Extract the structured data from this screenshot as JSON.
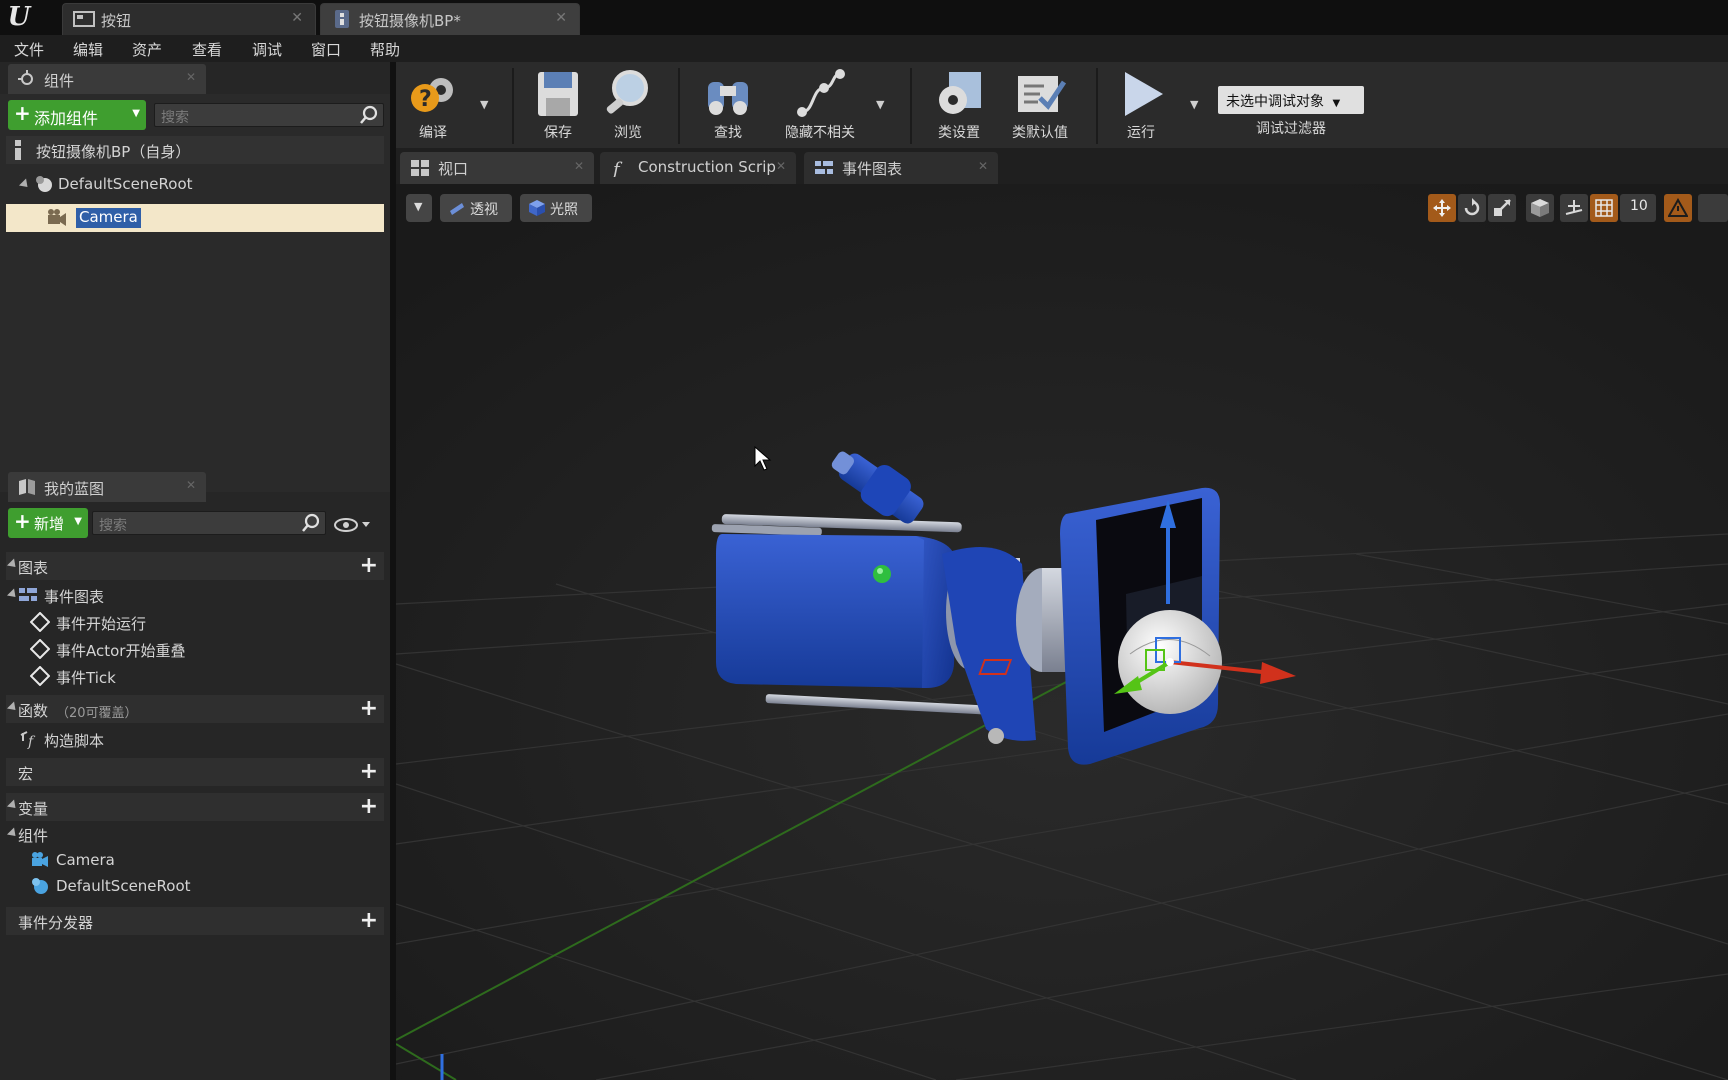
{
  "titlebar": {
    "tabs": [
      {
        "label": "按钮",
        "icon": "level-icon"
      },
      {
        "label": "按钮摄像机BP*",
        "icon": "blueprint-icon"
      }
    ]
  },
  "menubar": {
    "items": [
      "文件",
      "编辑",
      "资产",
      "查看",
      "调试",
      "窗口",
      "帮助"
    ]
  },
  "components_panel": {
    "tab_label": "组件",
    "add_button": "添加组件",
    "search_placeholder": "搜索",
    "self_label": "按钮摄像机BP（自身）",
    "tree": [
      {
        "label": "DefaultSceneRoot",
        "icon": "scene-root-icon"
      },
      {
        "label": "Camera",
        "icon": "camera-icon",
        "selected": true
      }
    ]
  },
  "my_blueprint_panel": {
    "tab_label": "我的蓝图",
    "add_button": "新增",
    "search_placeholder": "搜索",
    "sections": {
      "graphs": "图表",
      "event_graph": "事件图表",
      "events": [
        "事件开始运行",
        "事件Actor开始重叠",
        "事件Tick"
      ],
      "functions": "函数",
      "functions_note": "（20可覆盖）",
      "construction_script": "构造脚本",
      "macros": "宏",
      "variables": "变量",
      "components": "组件",
      "component_items": [
        "Camera",
        "DefaultSceneRoot"
      ],
      "event_dispatchers": "事件分发器"
    }
  },
  "toolbar": {
    "compile": "编译",
    "save": "保存",
    "browse": "浏览",
    "find": "查找",
    "hide_unrelated": "隐藏不相关",
    "class_settings": "类设置",
    "class_defaults": "类默认值",
    "play": "运行",
    "debug_object": "未选中调试对象",
    "debug_filter": "调试过滤器"
  },
  "editor_tabs": [
    {
      "label": "视口",
      "icon": "viewport-icon"
    },
    {
      "label": "Construction Scrip",
      "icon": "function-icon"
    },
    {
      "label": "事件图表",
      "icon": "graph-icon"
    }
  ],
  "viewport": {
    "perspective_label": "透视",
    "lit_label": "光照",
    "grid_snap": "10"
  },
  "colors": {
    "accent_green": "#3f9e2f",
    "selection": "#f3e7c9",
    "camera_blue": "#1f43b4",
    "axis_x": "#d1311c",
    "axis_y": "#55c416",
    "axis_z": "#2f6fe0"
  }
}
